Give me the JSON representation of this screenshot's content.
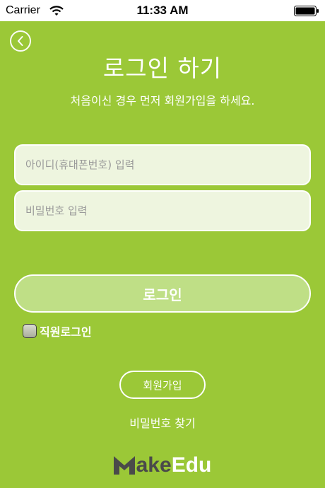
{
  "status_bar": {
    "carrier": "Carrier",
    "time": "11:33 AM"
  },
  "header": {
    "title": "로그인 하기",
    "subtitle": "처음이신 경우 먼저 회원가입을 하세요."
  },
  "form": {
    "id_placeholder": "아이디(휴대폰번호) 입력",
    "password_placeholder": "비밀번호 입력",
    "login_label": "로그인",
    "staff_login_label": "직원로그인"
  },
  "footer": {
    "signup_label": "회원가입",
    "find_password_label": "비밀번호 찾기",
    "logo_text": "MakeEdu"
  },
  "colors": {
    "background": "#9bc837",
    "field_bg": "#eef5df",
    "login_button_bg": "#bfdf86",
    "logo_dark": "#4a4a4a"
  }
}
